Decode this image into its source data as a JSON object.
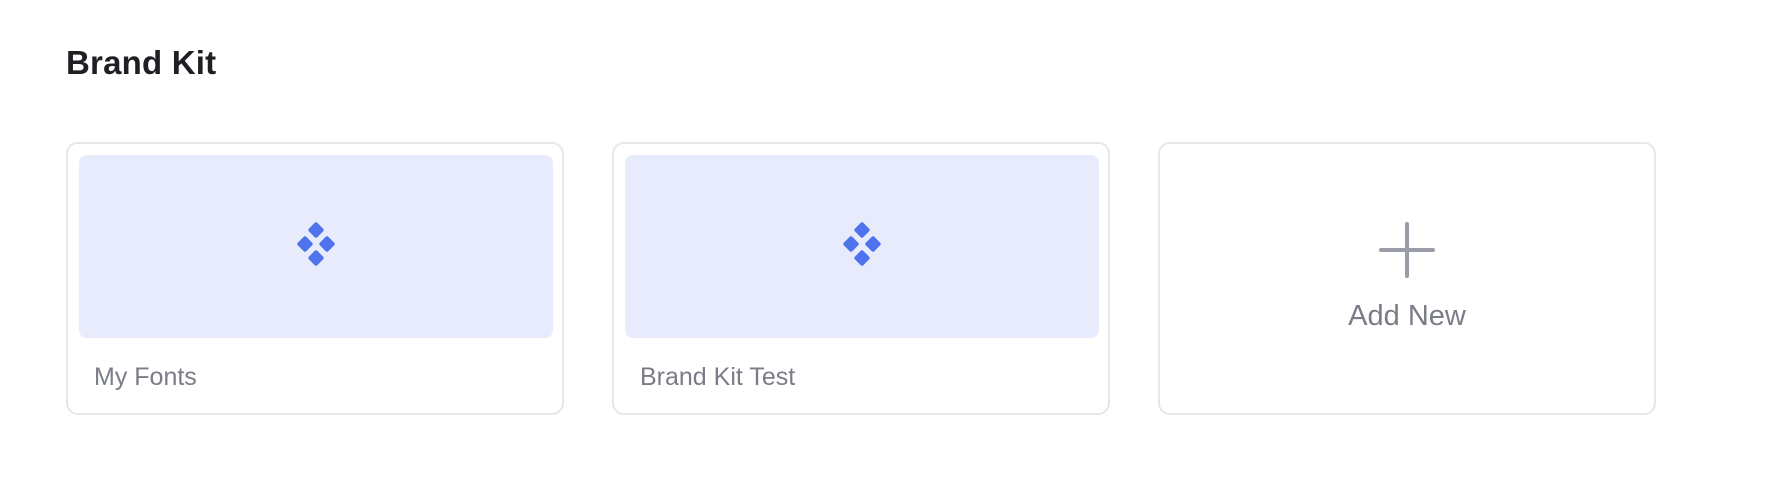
{
  "section": {
    "title": "Brand Kit"
  },
  "cards": [
    {
      "label": "My Fonts",
      "thumbnail_icon": "diamond-grid-icon"
    },
    {
      "label": "Brand Kit Test",
      "thumbnail_icon": "diamond-grid-icon"
    }
  ],
  "add_card": {
    "label": "Add New",
    "icon": "plus-icon"
  },
  "colors": {
    "accent": "#4f73ec",
    "thumbnail_bg": "#e7ebfb",
    "card_border": "#e6e7ec",
    "label_text": "#7a7d88",
    "title_text": "#1f1f24",
    "plus_icon": "#9a9caa"
  }
}
